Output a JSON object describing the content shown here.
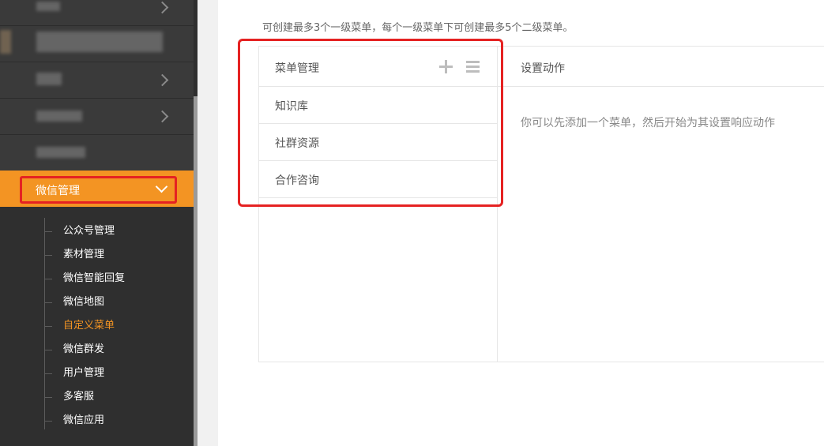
{
  "sidebar": {
    "active_group": {
      "label": "微信管理"
    },
    "submenu": [
      {
        "label": "公众号管理",
        "active": false
      },
      {
        "label": "素材管理",
        "active": false
      },
      {
        "label": "微信智能回复",
        "active": false
      },
      {
        "label": "微信地图",
        "active": false
      },
      {
        "label": "自定义菜单",
        "active": true
      },
      {
        "label": "微信群发",
        "active": false
      },
      {
        "label": "用户管理",
        "active": false
      },
      {
        "label": "多客服",
        "active": false
      },
      {
        "label": "微信应用",
        "active": false
      }
    ]
  },
  "main": {
    "tip": "可创建最多3个一级菜单，每个一级菜单下可创建最多5个二级菜单。",
    "menu_panel": {
      "title": "菜单管理",
      "items": [
        {
          "label": "知识库"
        },
        {
          "label": "社群资源"
        },
        {
          "label": "合作咨询"
        }
      ]
    },
    "action_panel": {
      "title": "设置动作",
      "hint": "你可以先添加一个菜单，然后开始为其设置响应动作"
    }
  },
  "colors": {
    "accent": "#f39423",
    "highlight_box": "#e52222",
    "sidebar_bg": "#3a3a3a"
  }
}
